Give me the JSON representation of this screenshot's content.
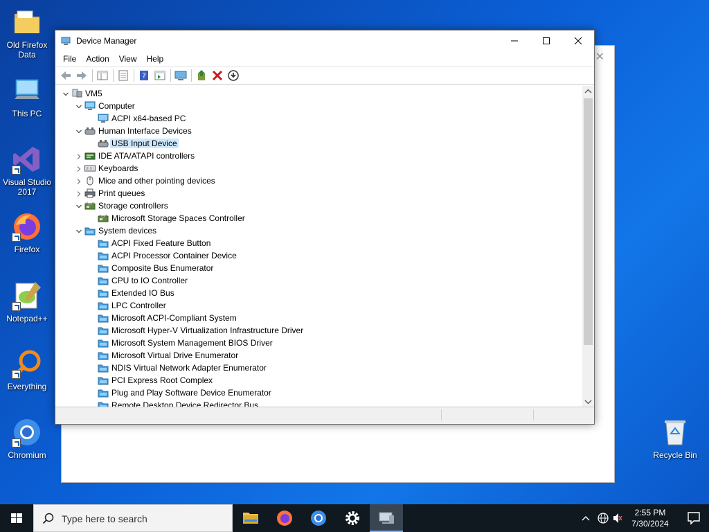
{
  "desktop": {
    "icons": [
      {
        "label": "Old Firefox Data"
      },
      {
        "label": "This PC"
      },
      {
        "label": "Visual Studio 2017"
      },
      {
        "label": "Firefox"
      },
      {
        "label": "Notepad++"
      },
      {
        "label": "Everything"
      },
      {
        "label": "Chromium"
      },
      {
        "label": "Recycle Bin"
      }
    ]
  },
  "window": {
    "title": "Device Manager",
    "menu": [
      "File",
      "Action",
      "View",
      "Help"
    ]
  },
  "tree": {
    "root": "VM5",
    "rows": [
      {
        "label": "VM5",
        "level": 0,
        "expander": "down",
        "icon": "computer-root-icon"
      },
      {
        "label": "Computer",
        "level": 1,
        "expander": "down",
        "icon": "monitor-icon"
      },
      {
        "label": "ACPI x64-based PC",
        "level": 2,
        "expander": "none",
        "icon": "monitor-icon"
      },
      {
        "label": "Human Interface Devices",
        "level": 1,
        "expander": "down",
        "icon": "hid-icon"
      },
      {
        "label": "USB Input Device",
        "level": 2,
        "expander": "none",
        "icon": "hid-icon",
        "selected": true
      },
      {
        "label": "IDE ATA/ATAPI controllers",
        "level": 1,
        "expander": "right",
        "icon": "ide-icon"
      },
      {
        "label": "Keyboards",
        "level": 1,
        "expander": "right",
        "icon": "keyboard-icon"
      },
      {
        "label": "Mice and other pointing devices",
        "level": 1,
        "expander": "right",
        "icon": "mouse-icon"
      },
      {
        "label": "Print queues",
        "level": 1,
        "expander": "right",
        "icon": "printer-icon"
      },
      {
        "label": "Storage controllers",
        "level": 1,
        "expander": "down",
        "icon": "storage-icon"
      },
      {
        "label": "Microsoft Storage Spaces Controller",
        "level": 2,
        "expander": "none",
        "icon": "storage-icon"
      },
      {
        "label": "System devices",
        "level": 1,
        "expander": "down",
        "icon": "system-folder-icon"
      },
      {
        "label": "ACPI Fixed Feature Button",
        "level": 2,
        "expander": "none",
        "icon": "system-device-icon"
      },
      {
        "label": "ACPI Processor Container Device",
        "level": 2,
        "expander": "none",
        "icon": "system-device-icon"
      },
      {
        "label": "Composite Bus Enumerator",
        "level": 2,
        "expander": "none",
        "icon": "system-device-icon"
      },
      {
        "label": "CPU to IO Controller",
        "level": 2,
        "expander": "none",
        "icon": "system-device-icon"
      },
      {
        "label": "Extended IO Bus",
        "level": 2,
        "expander": "none",
        "icon": "system-device-icon"
      },
      {
        "label": "LPC Controller",
        "level": 2,
        "expander": "none",
        "icon": "system-device-icon"
      },
      {
        "label": "Microsoft ACPI-Compliant System",
        "level": 2,
        "expander": "none",
        "icon": "system-device-icon"
      },
      {
        "label": "Microsoft Hyper-V Virtualization Infrastructure Driver",
        "level": 2,
        "expander": "none",
        "icon": "system-device-icon"
      },
      {
        "label": "Microsoft System Management BIOS Driver",
        "level": 2,
        "expander": "none",
        "icon": "system-device-icon"
      },
      {
        "label": "Microsoft Virtual Drive Enumerator",
        "level": 2,
        "expander": "none",
        "icon": "system-device-icon"
      },
      {
        "label": "NDIS Virtual Network Adapter Enumerator",
        "level": 2,
        "expander": "none",
        "icon": "system-device-icon"
      },
      {
        "label": "PCI Express Root Complex",
        "level": 2,
        "expander": "none",
        "icon": "system-device-icon"
      },
      {
        "label": "Plug and Play Software Device Enumerator",
        "level": 2,
        "expander": "none",
        "icon": "system-device-icon"
      },
      {
        "label": "Remote Desktop Device Redirector Bus",
        "level": 2,
        "expander": "none",
        "icon": "system-device-icon"
      }
    ]
  },
  "taskbar": {
    "search_placeholder": "Type here to search",
    "time": "2:55 PM",
    "date": "7/30/2024"
  },
  "colors": {
    "accent": "#0078d7",
    "selection": "#cce8ff",
    "taskbar": "#101820"
  }
}
